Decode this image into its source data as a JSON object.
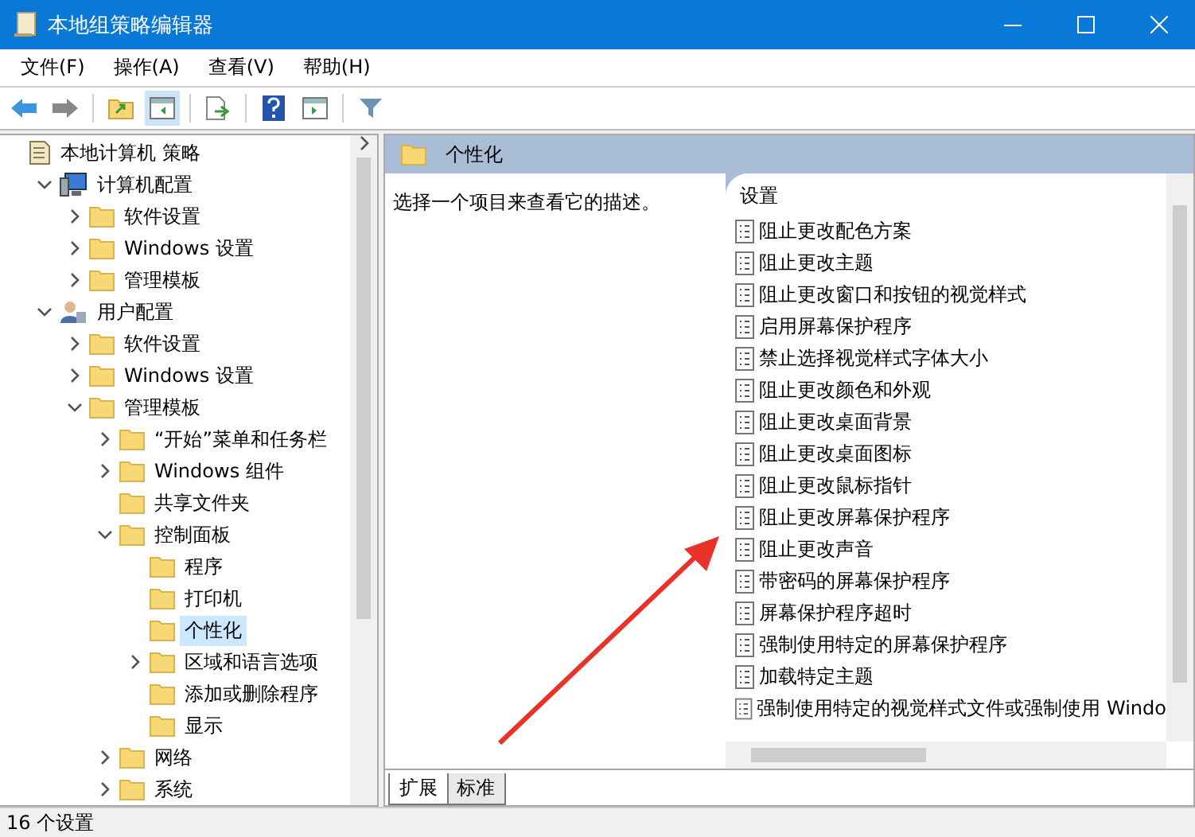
{
  "window": {
    "title": "本地组策略编辑器"
  },
  "menu": [
    "文件(F)",
    "操作(A)",
    "查看(V)",
    "帮助(H)"
  ],
  "tree": [
    {
      "label": "本地计算机 策略",
      "kind": "policy",
      "selected": false,
      "children": [
        {
          "label": "计算机配置",
          "kind": "computer",
          "expanded": true,
          "selected": false,
          "children": [
            {
              "label": "软件设置",
              "kind": "folder",
              "expanded": false,
              "selected": false
            },
            {
              "label": "Windows 设置",
              "kind": "folder",
              "expanded": false,
              "selected": false
            },
            {
              "label": "管理模板",
              "kind": "folder",
              "expanded": false,
              "selected": false
            }
          ]
        },
        {
          "label": "用户配置",
          "kind": "user",
          "expanded": true,
          "selected": false,
          "children": [
            {
              "label": "软件设置",
              "kind": "folder",
              "expanded": false,
              "selected": false
            },
            {
              "label": "Windows 设置",
              "kind": "folder",
              "expanded": false,
              "selected": false
            },
            {
              "label": "管理模板",
              "kind": "folder",
              "expanded": true,
              "selected": false,
              "children": [
                {
                  "label": "“开始”菜单和任务栏",
                  "kind": "folder",
                  "expanded": false,
                  "selected": false
                },
                {
                  "label": "Windows 组件",
                  "kind": "folder",
                  "expanded": false,
                  "selected": false
                },
                {
                  "label": "共享文件夹",
                  "kind": "folder",
                  "selected": false
                },
                {
                  "label": "控制面板",
                  "kind": "folder",
                  "expanded": true,
                  "selected": false,
                  "children": [
                    {
                      "label": "程序",
                      "kind": "folder",
                      "selected": false
                    },
                    {
                      "label": "打印机",
                      "kind": "folder",
                      "selected": false
                    },
                    {
                      "label": "个性化",
                      "kind": "folder",
                      "selected": true
                    },
                    {
                      "label": "区域和语言选项",
                      "kind": "folder",
                      "expanded": false,
                      "selected": false
                    },
                    {
                      "label": "添加或删除程序",
                      "kind": "folder",
                      "selected": false
                    },
                    {
                      "label": "显示",
                      "kind": "folder",
                      "selected": false
                    }
                  ]
                },
                {
                  "label": "网络",
                  "kind": "folder",
                  "expanded": false,
                  "selected": false
                },
                {
                  "label": "系统",
                  "kind": "folder",
                  "expanded": false,
                  "selected": false
                }
              ]
            }
          ]
        }
      ]
    }
  ],
  "details": {
    "title": "个性化",
    "description": "选择一个项目来查看它的描述。",
    "column": "设置",
    "settings": [
      "阻止更改配色方案",
      "阻止更改主题",
      "阻止更改窗口和按钮的视觉样式",
      "启用屏幕保护程序",
      "禁止选择视觉样式字体大小",
      "阻止更改颜色和外观",
      "阻止更改桌面背景",
      "阻止更改桌面图标",
      "阻止更改鼠标指针",
      "阻止更改屏幕保护程序",
      "阻止更改声音",
      "带密码的屏幕保护程序",
      "屏幕保护程序超时",
      "强制使用特定的屏幕保护程序",
      "加载特定主题",
      "强制使用特定的视觉样式文件或强制使用 Windo"
    ],
    "tabs": [
      {
        "label": "扩展",
        "selected": true
      },
      {
        "label": "标准",
        "selected": false
      }
    ]
  },
  "status_bar": "16 个设置"
}
